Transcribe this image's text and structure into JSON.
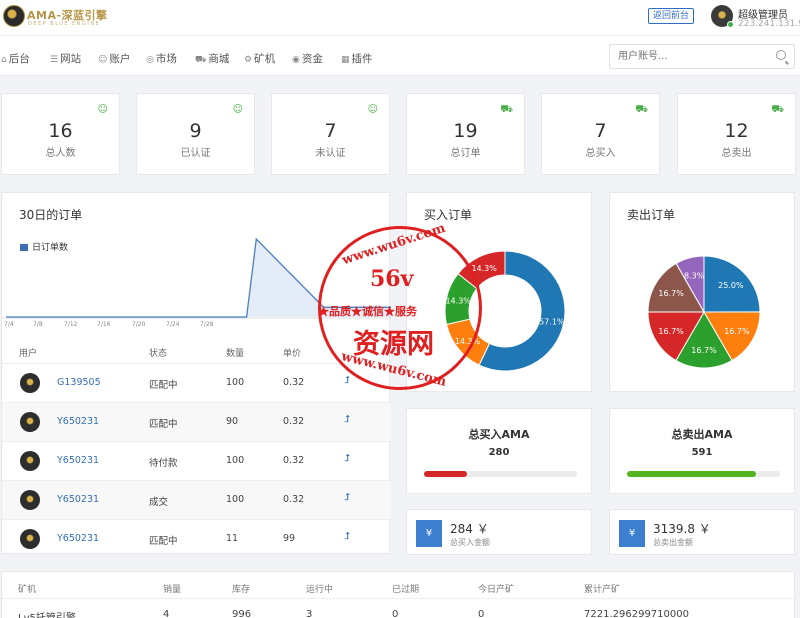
{
  "header": {
    "logo_text": "AMA-深蓝引擎",
    "logo_sub": "DEEP BLUE ENGINE",
    "back_button": "返回前台",
    "user_name": "超级管理员",
    "user_ip": "223.241.131.91"
  },
  "nav": {
    "items": [
      {
        "label": "后台",
        "icon": "home-icon"
      },
      {
        "label": "网站",
        "icon": "list-icon"
      },
      {
        "label": "账户",
        "icon": "users-icon"
      },
      {
        "label": "市场",
        "icon": "globe-icon"
      },
      {
        "label": "商城",
        "icon": "cart-icon"
      },
      {
        "label": "矿机",
        "icon": "gear-icon"
      },
      {
        "label": "资金",
        "icon": "coin-icon"
      },
      {
        "label": "插件",
        "icon": "grid-icon"
      }
    ],
    "search_placeholder": "用户账号..."
  },
  "stats": [
    {
      "value": "16",
      "label": "总人数",
      "icon": "user-icon"
    },
    {
      "value": "9",
      "label": "已认证",
      "icon": "user-icon"
    },
    {
      "value": "7",
      "label": "未认证",
      "icon": "user-icon"
    },
    {
      "value": "19",
      "label": "总订单",
      "icon": "cart-icon"
    },
    {
      "value": "7",
      "label": "总买入",
      "icon": "cart-icon"
    },
    {
      "value": "12",
      "label": "总卖出",
      "icon": "cart-icon"
    }
  ],
  "orders": {
    "title": "30日的订单",
    "columns": [
      "用户",
      "状态",
      "数量",
      "单价"
    ],
    "rows": [
      {
        "user": "G139505",
        "status": "匹配中",
        "qty": "100",
        "price": "0.32"
      },
      {
        "user": "Y650231",
        "status": "匹配中",
        "qty": "90",
        "price": "0.32"
      },
      {
        "user": "Y650231",
        "status": "待付款",
        "qty": "100",
        "price": "0.32"
      },
      {
        "user": "Y650231",
        "status": "成交",
        "qty": "100",
        "price": "0.32"
      },
      {
        "user": "Y650231",
        "status": "匹配中",
        "qty": "11",
        "price": "99"
      }
    ]
  },
  "buy_panel": {
    "title": "买入订单"
  },
  "sell_panel": {
    "title": "卖出订单"
  },
  "totals": {
    "buy_title": "总买入AMA",
    "buy_value": "280",
    "buy_progress": 0.28,
    "sell_title": "总卖出AMA",
    "sell_value": "591",
    "sell_progress": 0.84
  },
  "money": {
    "buy_value": "284 ￥",
    "buy_label": "总买入金额",
    "sell_value": "3139.8 ￥",
    "sell_label": "总卖出金额",
    "icon_char": "¥"
  },
  "miners": {
    "columns": [
      "矿机",
      "销量",
      "库存",
      "运行中",
      "已过期",
      "今日产矿",
      "累计产矿"
    ],
    "row": [
      "Lv5托管引擎",
      "4",
      "996",
      "3",
      "0",
      "0",
      "7221.296299710000"
    ]
  },
  "watermark": {
    "top_arc": "www.wu6v.com",
    "big": "56v",
    "middle": "★品质★诚信★服务",
    "brand": "资源网",
    "bottom_arc": "www.wu6v.com"
  },
  "colors": {
    "accent": "#3d7fcf",
    "green": "#4aad47",
    "red": "#d62728",
    "blue": "#1f77b4",
    "orange": "#ff7f0e",
    "purple": "#9467bd",
    "brown": "#8c564b"
  },
  "chart_data": [
    {
      "type": "line",
      "legend": [
        "日订单数"
      ],
      "categories": [
        "7/4",
        "7/8",
        "7/12",
        "7/16",
        "7/20",
        "7/24",
        "7/28"
      ],
      "series": [
        {
          "name": "日订单数",
          "values": [
            0,
            0,
            0,
            0,
            0,
            0,
            0,
            0,
            0,
            0,
            0,
            0,
            0,
            0,
            0,
            0,
            0,
            0,
            0,
            0,
            0,
            0,
            0,
            0,
            0,
            0,
            8,
            7,
            6,
            5,
            4,
            3,
            2,
            1,
            1,
            1,
            1,
            1,
            1,
            1,
            1
          ]
        }
      ]
    },
    {
      "type": "pie",
      "title": "买入订单",
      "labels": [
        "57.1%",
        "14.3%",
        "14.3%",
        "14.3%"
      ],
      "values": [
        57.1,
        14.3,
        14.3,
        14.3
      ],
      "slice_colors": [
        "#1f77b4",
        "#ff7f0e",
        "#2ca02c",
        "#d62728"
      ]
    },
    {
      "type": "pie",
      "title": "卖出订单",
      "labels": [
        "25.0%",
        "16.7%",
        "16.7%",
        "16.7%",
        "16.7%",
        "8.3%"
      ],
      "values": [
        25.0,
        16.7,
        16.7,
        16.7,
        16.7,
        8.3
      ],
      "slice_colors": [
        "#1f77b4",
        "#ff7f0e",
        "#2ca02c",
        "#d62728",
        "#8c564b",
        "#9467bd"
      ]
    }
  ]
}
